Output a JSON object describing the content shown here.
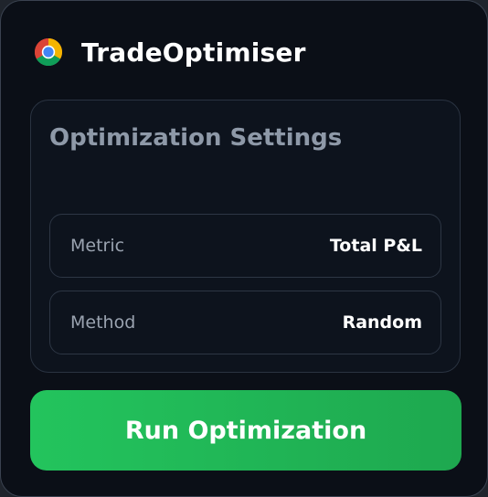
{
  "app": {
    "title": "TradeOptimiser",
    "icon": "chrome-icon"
  },
  "settings": {
    "title": "Optimization Settings",
    "rows": [
      {
        "label": "Metric",
        "value": "Total P&L"
      },
      {
        "label": "Method",
        "value": "Random"
      }
    ]
  },
  "actions": {
    "run_label": "Run Optimization"
  },
  "colors": {
    "background": "#0b0f17",
    "card": "#0d131d",
    "border": "#2a3341",
    "accent": "#22c55e",
    "muted_text": "#8e99a8"
  }
}
